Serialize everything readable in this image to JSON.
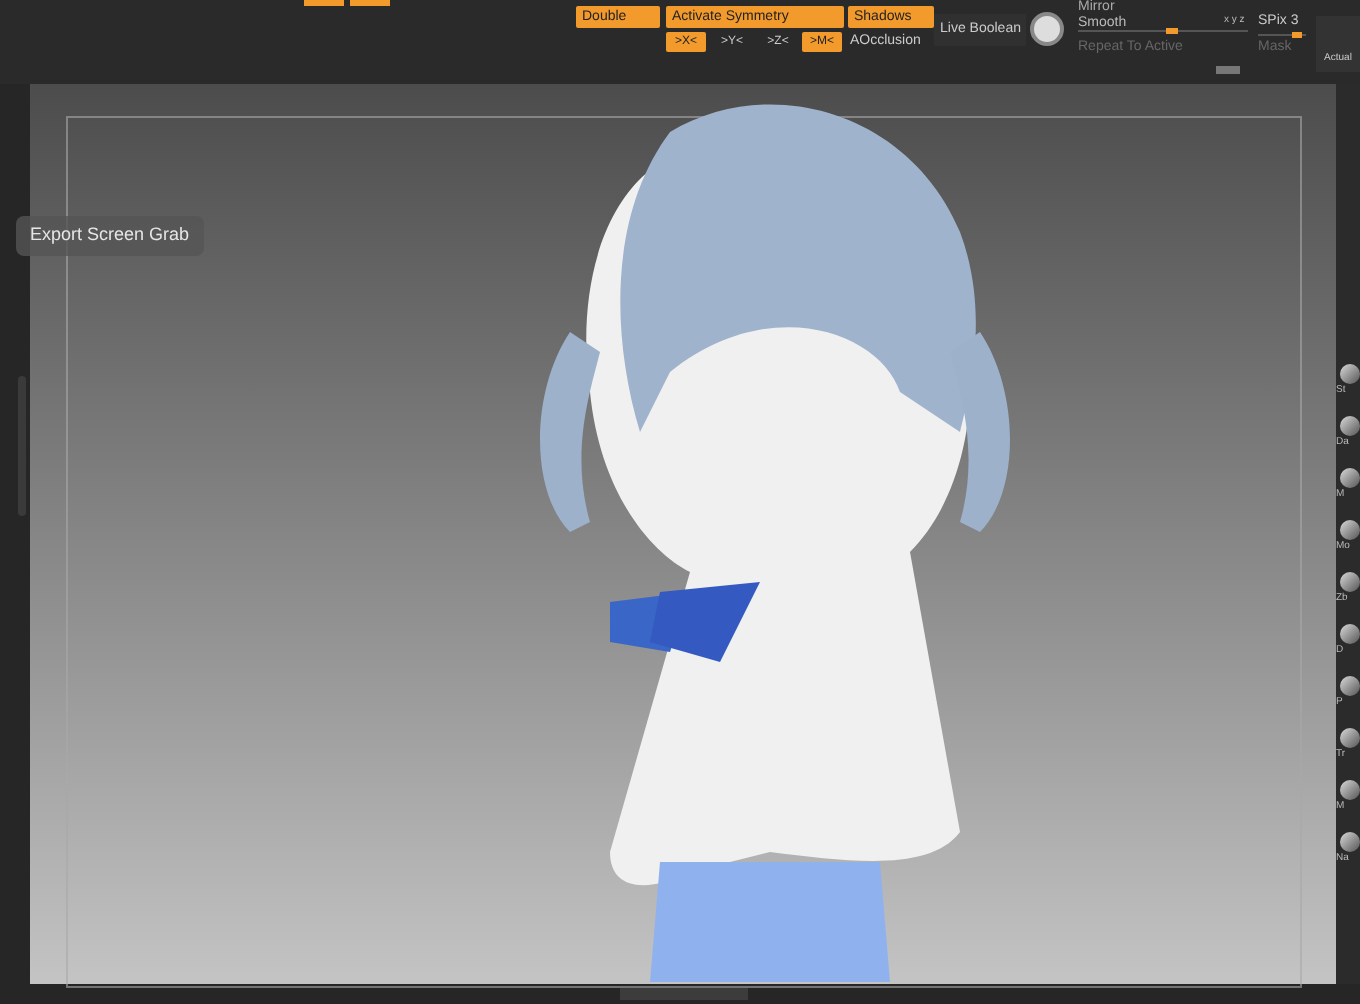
{
  "toolbar": {
    "buttons": [
      {
        "label": "Double",
        "on": true
      },
      {
        "label": "Activate Symmetry",
        "on": true
      },
      {
        "label": "Shadows",
        "on": true
      }
    ],
    "axes": [
      {
        "label": ">X<",
        "on": true
      },
      {
        "label": ">Y<",
        "on": false
      },
      {
        "label": ">Z<",
        "on": false
      },
      {
        "label": ">M<",
        "on": true
      }
    ],
    "aocclusion": "AOcclusion",
    "live_boolean": "Live Boolean",
    "mirror": "Mirror",
    "smooth": {
      "label": "Smooth",
      "axes": "x y z",
      "level": 0.55
    },
    "repeat_to_active": "Repeat To Active",
    "spix": {
      "label": "SPix 3",
      "level": 0.8
    },
    "mask": "Mask",
    "actual": "Actual"
  },
  "tooltip": "Export Screen Grab",
  "shelf": [
    "St",
    "Da",
    "M",
    "Mo",
    "Zb",
    "D",
    "P",
    "Tr",
    "M",
    "Na"
  ]
}
